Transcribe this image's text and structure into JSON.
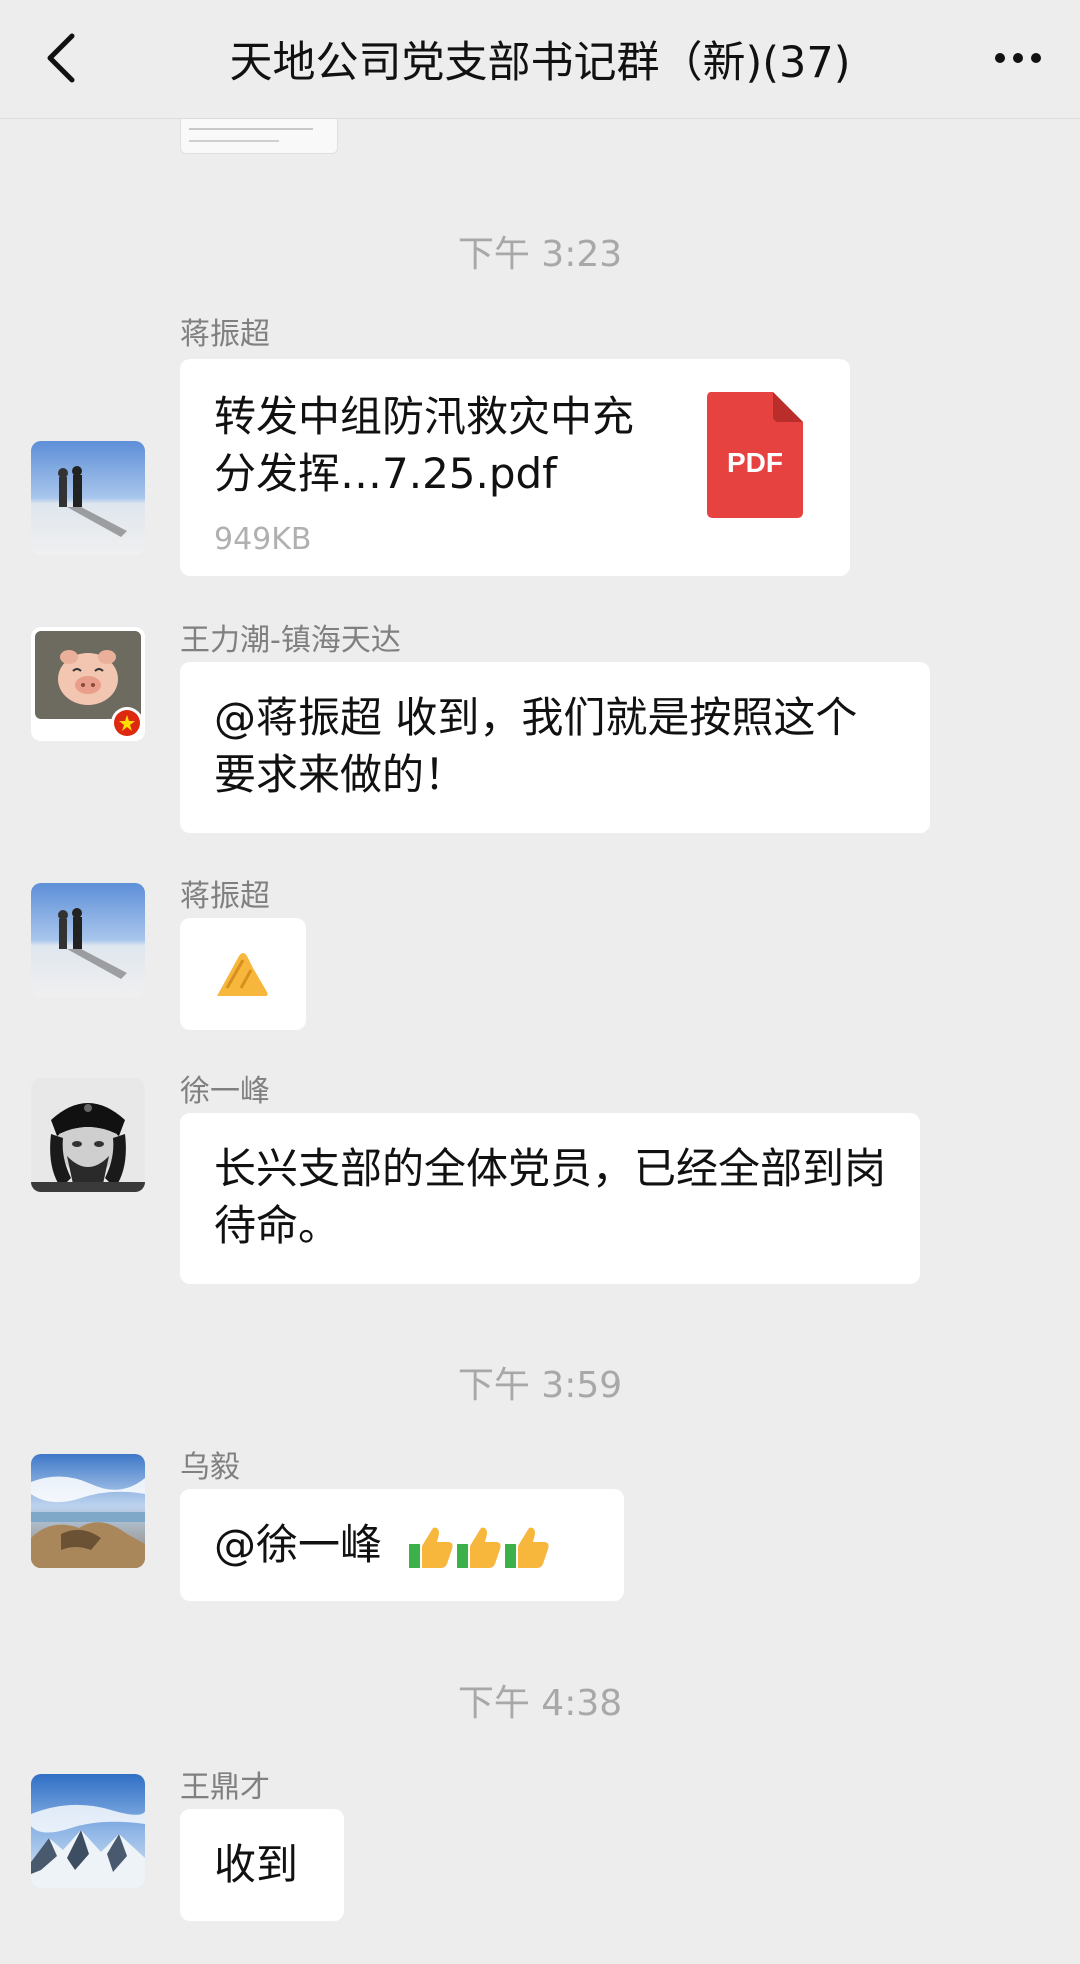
{
  "nav": {
    "title": "天地公司党支部书记群（新)(37)",
    "back_icon": "chevron-left-icon",
    "more_icon": "more-dots-icon"
  },
  "timestamps": [
    "下午 3:23",
    "下午 3:59",
    "下午 4:38"
  ],
  "messages": [
    {
      "sender": "蒋振超",
      "type": "file",
      "file_name": "转发中组防汛救灾中充分发挥…7.25.pdf",
      "file_size": "949KB",
      "file_icon": "PDF"
    },
    {
      "sender": "王力潮-镇海天达",
      "type": "text",
      "text": "@蒋振超 收到，我们就是按照这个要求来做的！"
    },
    {
      "sender": "蒋振超",
      "type": "emoji",
      "emoji": "ok-hand-emoji"
    },
    {
      "sender": "徐一峰",
      "type": "text",
      "text": "长兴支部的全体党员，已经全部到岗待命。"
    },
    {
      "sender": "乌毅",
      "type": "text",
      "text": "@徐一峰",
      "emoji": "thumbs-up-emoji x3"
    },
    {
      "sender": "王鼎才",
      "type": "text",
      "text": "收到"
    }
  ],
  "colors": {
    "background": "#ededed",
    "bubble": "#ffffff",
    "pdf_red": "#e64340"
  }
}
